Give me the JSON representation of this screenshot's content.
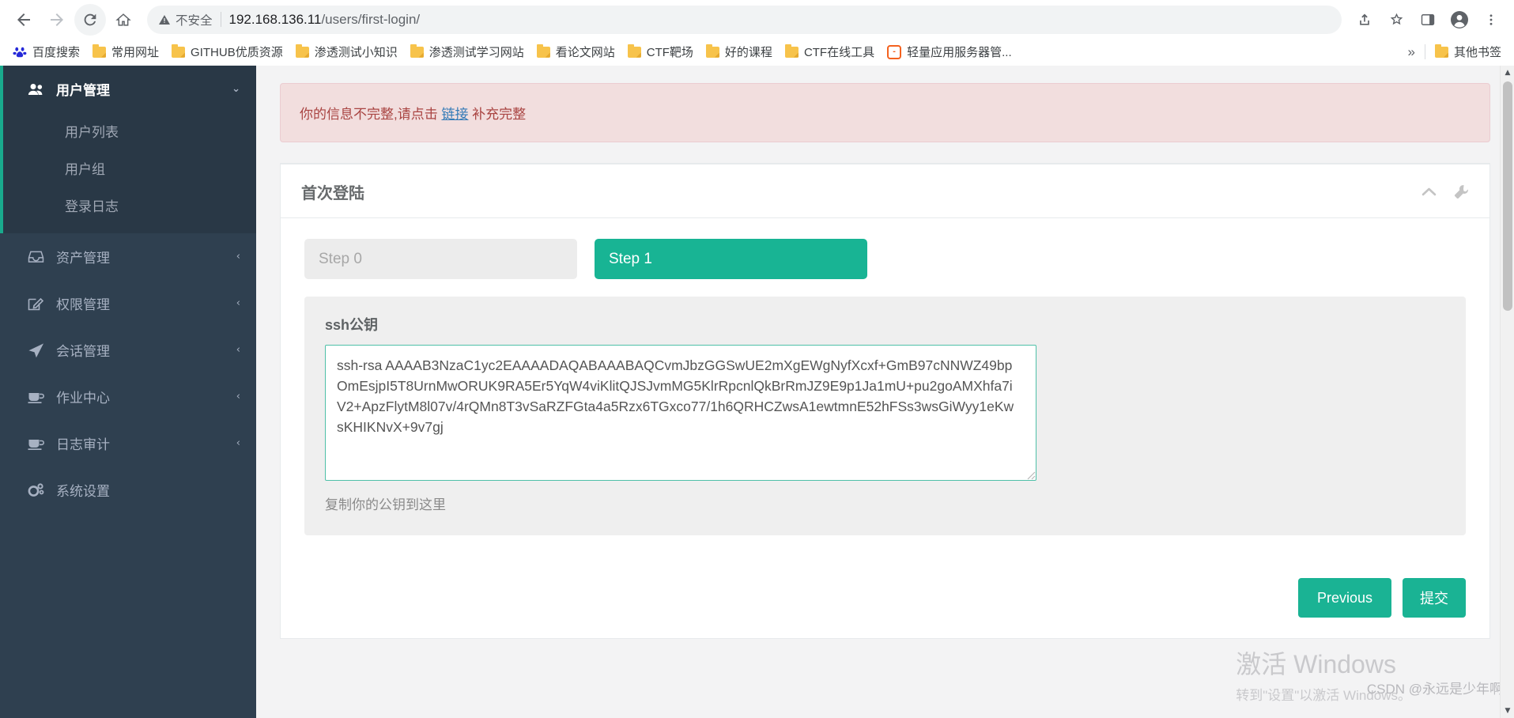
{
  "browser": {
    "nav": {
      "back": "back-arrow",
      "forward": "forward-arrow",
      "reload": "reload",
      "home": "home"
    },
    "omnibox": {
      "security_label": "不安全",
      "url_host": "192.168.136.11",
      "url_path": "/users/first-login/",
      "full_url": "192.168.136.11/users/first-login/"
    },
    "toolbar_icons": [
      "share-icon",
      "star-icon",
      "sidepanel-icon",
      "profile-icon",
      "more-menu-icon"
    ],
    "bookmarks": [
      {
        "label": "百度搜索",
        "icon": "baidu-icon"
      },
      {
        "label": "常用网址",
        "icon": "folder-icon"
      },
      {
        "label": "GITHUB优质资源",
        "icon": "folder-icon"
      },
      {
        "label": "渗透测试小知识",
        "icon": "folder-icon"
      },
      {
        "label": "渗透测试学习网站",
        "icon": "folder-icon"
      },
      {
        "label": "看论文网站",
        "icon": "folder-icon"
      },
      {
        "label": "CTF靶场",
        "icon": "folder-icon"
      },
      {
        "label": "好的课程",
        "icon": "folder-icon"
      },
      {
        "label": "CTF在线工具",
        "icon": "folder-icon"
      },
      {
        "label": "轻量应用服务器管...",
        "icon": "orange-bracket-icon"
      }
    ],
    "bookmarks_overflow": "»",
    "other_bookmarks": {
      "label": "其他书签",
      "icon": "folder-icon"
    }
  },
  "sidebar": {
    "groups": [
      {
        "label": "用户管理",
        "icon": "users-icon",
        "caret": "⌄",
        "active": true,
        "children": [
          {
            "label": "用户列表"
          },
          {
            "label": "用户组"
          },
          {
            "label": "登录日志"
          }
        ]
      },
      {
        "label": "资产管理",
        "icon": "inbox-icon",
        "caret": "‹",
        "active": false,
        "children": []
      },
      {
        "label": "权限管理",
        "icon": "edit-square-icon",
        "caret": "‹",
        "active": false,
        "children": []
      },
      {
        "label": "会话管理",
        "icon": "rocket-icon",
        "caret": "‹",
        "active": false,
        "children": []
      },
      {
        "label": "作业中心",
        "icon": "coffee-icon",
        "caret": "‹",
        "active": false,
        "children": []
      },
      {
        "label": "日志审计",
        "icon": "coffee-icon",
        "caret": "‹",
        "active": false,
        "children": []
      },
      {
        "label": "系统设置",
        "icon": "gears-icon",
        "caret": "",
        "active": false,
        "children": []
      }
    ]
  },
  "main": {
    "alert": {
      "text_before": "你的信息不完整,请点击 ",
      "link_text": "链接",
      "text_after": " 补充完整"
    },
    "panel": {
      "title": "首次登陆",
      "tools": [
        {
          "name": "collapse-chevron-icon"
        },
        {
          "name": "wrench-icon"
        }
      ],
      "steps": [
        {
          "label": "Step 0",
          "active": false
        },
        {
          "label": "Step 1",
          "active": true
        }
      ],
      "form": {
        "field_label": "ssh公钥",
        "ssh_key_value": "ssh-rsa AAAAB3NzaC1yc2EAAAADAQABAAABAQCvmJbzGGSwUE2mXgEWgNyfXcxf+GmB97cNNWZ49bpOmEsjpI5T8UrnMwORUK9RA5Er5YqW4viKlitQJSJvmMG5KlrRpcnlQkBrRmJZ9E9p1Ja1mU+pu2goAMXhfa7iV2+ApzFlytM8l07v/4rQMn8T3vSaRZFGta4a5Rzx6TGxco77/1h6QRHCZwsA1ewtmnE52hFSs3wsGiWyy1eKwsKHIKNvX+9v7gj",
        "ssh_key_placeholder": "",
        "help_text": "复制你的公钥到这里"
      },
      "buttons": {
        "previous": "Previous",
        "submit": "提交"
      }
    }
  },
  "watermarks": {
    "windows_line1": "激活 Windows",
    "windows_line2": "转到\"设置\"以激活 Windows。",
    "csdn": "CSDN @永远是少年啊"
  },
  "colors": {
    "accent_green": "#1ab394",
    "step_active": "#18b494",
    "sidebar_bg": "#2f4050",
    "sidebar_active_bg": "#293846",
    "alert_bg": "#f2dede",
    "alert_text": "#a94442",
    "link_blue": "#337ab7"
  }
}
